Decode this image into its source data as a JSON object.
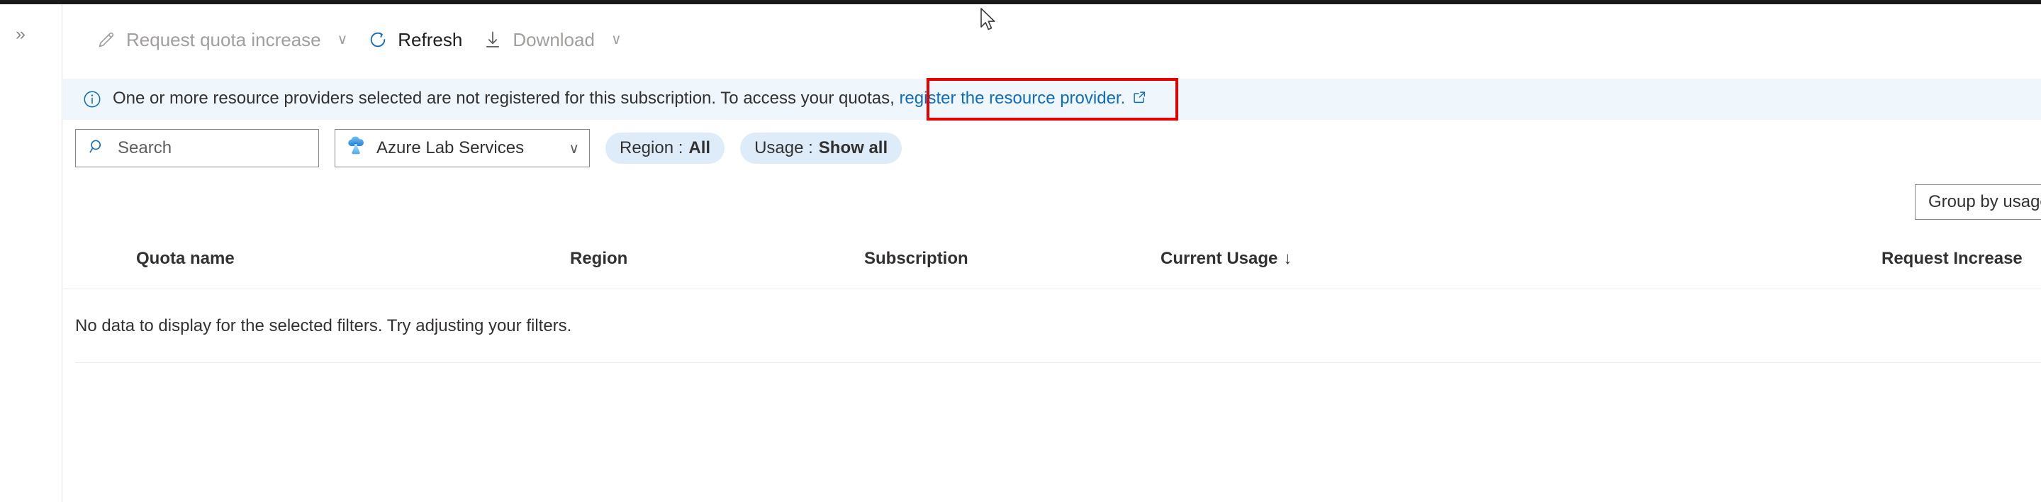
{
  "rail": {
    "expand_icon": "double-chevron-right-icon",
    "expand_glyph": "»"
  },
  "toolbar": {
    "buttons": [
      {
        "label": "Request quota increase",
        "icon": "pencil-icon",
        "disabled": true,
        "has_caret": true
      },
      {
        "label": "Refresh",
        "icon": "refresh-icon",
        "disabled": false,
        "has_caret": false
      },
      {
        "label": "Download",
        "icon": "download-icon",
        "disabled": true,
        "has_caret": true
      }
    ],
    "caret_glyph": "∨"
  },
  "notification": {
    "icon": "info-circle-icon",
    "message": "One or more resource providers selected are not registered for this subscription. To access your quotas,",
    "link_text": "register the resource provider.",
    "link_icon": "external-link-icon",
    "background": "#eff6fc",
    "link_color": "#0f6cbd",
    "highlight_color": "#e60000"
  },
  "filters": {
    "search": {
      "placeholder": "Search",
      "value": "",
      "icon": "search-icon"
    },
    "provider": {
      "value": "Azure Lab Services",
      "icon": "azure-lab-services-icon",
      "caret_glyph": "∨"
    },
    "pills": [
      {
        "label": "Region :",
        "value": "All"
      },
      {
        "label": "Usage :",
        "value": "Show all"
      }
    ],
    "group_by": {
      "value": "Group by usage"
    }
  },
  "table": {
    "columns": [
      {
        "label": "Quota name",
        "sorted": false
      },
      {
        "label": "Region",
        "sorted": false
      },
      {
        "label": "Subscription",
        "sorted": false
      },
      {
        "label": "Current Usage",
        "sorted": true,
        "sort_glyph": "↓"
      },
      {
        "label": "Request Increase",
        "sorted": false
      }
    ],
    "empty_message": "No data to display for the selected filters. Try adjusting your filters."
  }
}
